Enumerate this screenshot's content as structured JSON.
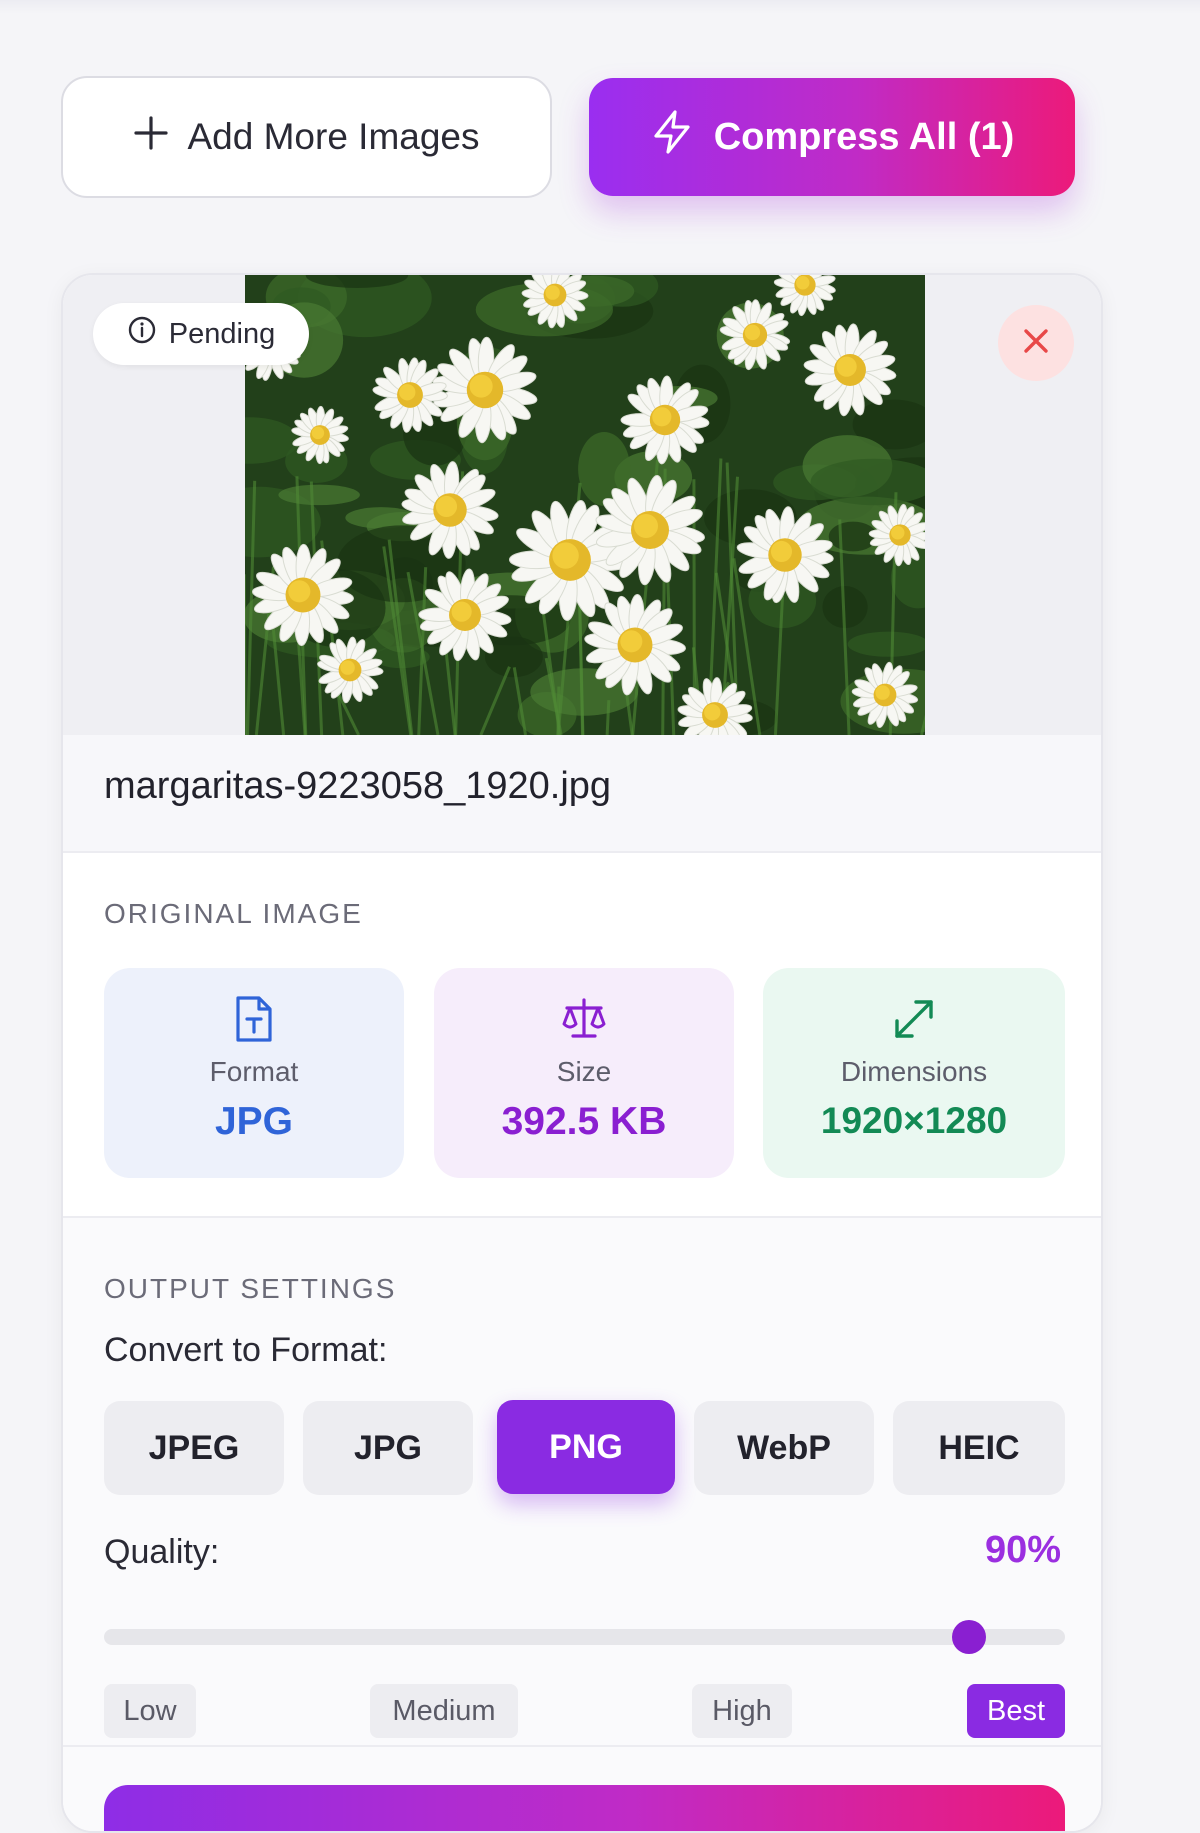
{
  "toolbar": {
    "add_label": "Add More Images",
    "compress_label": "Compress All (1)"
  },
  "image_card": {
    "status": "Pending",
    "filename": "margaritas-9223058_1920.jpg",
    "original_section_label": "ORIGINAL IMAGE",
    "stats": {
      "format_label": "Format",
      "format_value": "JPG",
      "size_label": "Size",
      "size_value": "392.5 KB",
      "dimensions_label": "Dimensions",
      "dimensions_value": "1920×1280"
    },
    "output_section_label": "OUTPUT SETTINGS",
    "convert_label": "Convert to Format:",
    "formats": [
      "JPEG",
      "JPG",
      "PNG",
      "WebP",
      "HEIC"
    ],
    "selected_format": "PNG",
    "quality_label": "Quality:",
    "quality_value": "90%",
    "quality_percent": 90,
    "quality_levels": [
      "Low",
      "Medium",
      "High",
      "Best"
    ],
    "selected_level": "Best"
  },
  "colors": {
    "accent": "#8a2be2",
    "gradient_start": "#9a2ef0",
    "gradient_end": "#ec1a7a",
    "format_blue": "#2f64d8",
    "size_purple": "#8a1fd1",
    "dimensions_green": "#138a55",
    "remove_red": "#e84848"
  }
}
